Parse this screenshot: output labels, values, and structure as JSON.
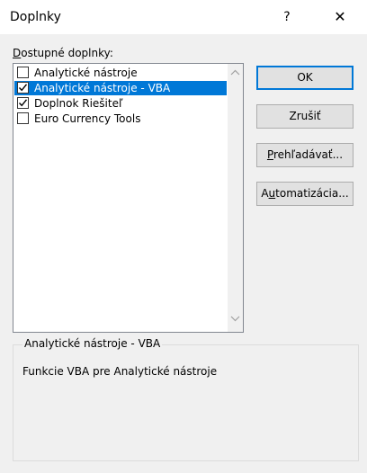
{
  "window": {
    "title": "Doplnky",
    "help_label": "?",
    "close_label": "✕"
  },
  "addins": {
    "label_prefix": "D",
    "label_rest": "ostupné doplnky:",
    "items": [
      {
        "label": "Analytické nástroje",
        "checked": false,
        "selected": false
      },
      {
        "label": "Analytické nástroje - VBA",
        "checked": true,
        "selected": true
      },
      {
        "label": "Doplnok Riešiteľ",
        "checked": true,
        "selected": false
      },
      {
        "label": "Euro Currency Tools",
        "checked": false,
        "selected": false
      }
    ]
  },
  "buttons": {
    "ok": "OK",
    "cancel": "Zrušiť",
    "browse_u": "P",
    "browse_rest": "rehľadávať...",
    "automation_pre": "A",
    "automation_u": "u",
    "automation_rest": "tomatizácia..."
  },
  "description": {
    "title": "Analytické nástroje - VBA",
    "text": "Funkcie VBA pre Analytické nástroje"
  }
}
